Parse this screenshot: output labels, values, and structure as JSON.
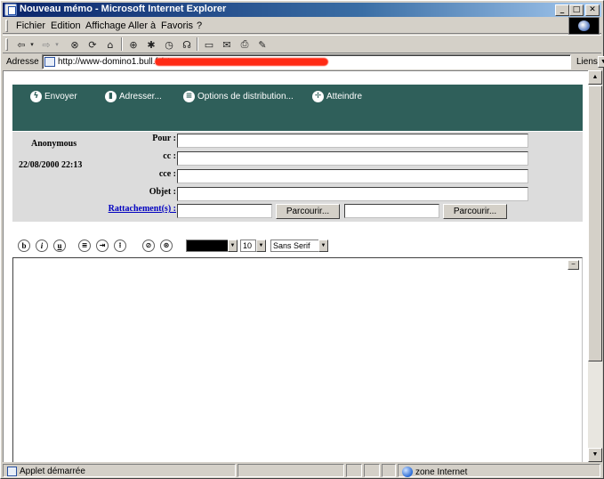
{
  "window": {
    "title": "Nouveau mémo - Microsoft Internet Explorer",
    "minimize": "_",
    "maximize": "□",
    "close": "✕"
  },
  "menu": {
    "items": [
      "Fichier",
      "Edition",
      "Affichage",
      "Aller à",
      "Favoris",
      "?"
    ]
  },
  "toolbar": {
    "icons": [
      "back-icon",
      "forward-icon",
      "stop-icon",
      "refresh-icon",
      "home-icon",
      "search-icon",
      "favorites-icon",
      "history-icon",
      "channels-icon",
      "fullscreen-icon",
      "mail-icon",
      "print-icon",
      "edit-icon"
    ]
  },
  "address": {
    "label": "Adresse",
    "url": "http://www-domino1.bull.fr/st",
    "links": "Liens"
  },
  "actions": {
    "send": "Envoyer",
    "address": "Adresser...",
    "delivery": "Options de distribution...",
    "goto": "Atteindre"
  },
  "memo": {
    "sender": "Anonymous",
    "datetime": "22/08/2000 22:13",
    "to_label": "Pour :",
    "cc_label": "cc :",
    "bcc_label": "cce :",
    "subject_label": "Objet :",
    "attach_label": "Rattachement(s) :",
    "to_value": "",
    "cc_value": "",
    "bcc_value": "",
    "subject_value": "",
    "attach1_value": "",
    "attach2_value": "",
    "browse1": "Parcourir...",
    "browse2": "Parcourir..."
  },
  "format": {
    "bold": "b",
    "italic": "i",
    "underline": "u",
    "color": "#000000",
    "size": "10",
    "font": "Sans Serif"
  },
  "status": {
    "text": "Applet démarrée",
    "zone": "zone Internet"
  }
}
